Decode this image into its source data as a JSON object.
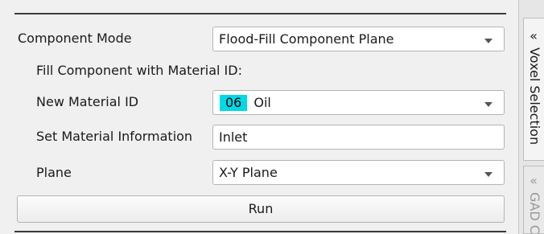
{
  "component_mode": {
    "label": "Component Mode",
    "value": "Flood-Fill Component Plane"
  },
  "fill_section": {
    "heading": "Fill Component with Material ID:"
  },
  "new_material": {
    "label": "New Material ID",
    "id": "06",
    "name": "Oil",
    "swatch_color": "#00d9e6"
  },
  "material_info": {
    "label": "Set Material Information",
    "value": "Inlet"
  },
  "plane": {
    "label": "Plane",
    "value": "X-Y Plane"
  },
  "run": {
    "label": "Run"
  },
  "dock": {
    "tabs": [
      {
        "chevron": "«",
        "label": "Voxel Selection"
      },
      {
        "chevron": "«",
        "label": "GAD C"
      }
    ]
  }
}
